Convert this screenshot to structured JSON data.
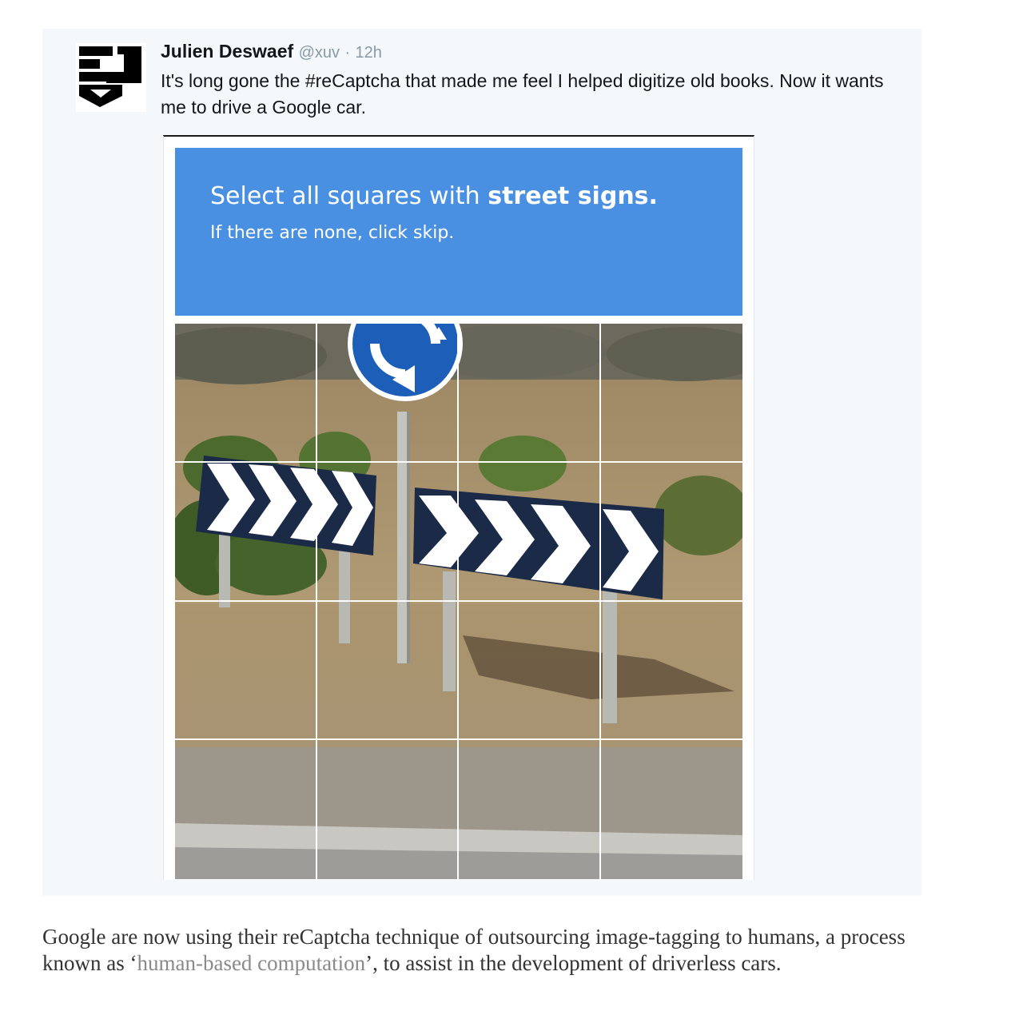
{
  "tweet": {
    "author_name": "Julien Deswaef",
    "handle": "@xuv",
    "separator": "·",
    "time": "12h",
    "text": "It's long gone the #reCaptcha that made me feel I helped digitize old books. Now it wants me to drive a Google car.",
    "avatar_icon": "xuv-logo-icon"
  },
  "captcha": {
    "prompt_prefix": "Select all squares with ",
    "prompt_target": "street signs.",
    "instruction": "If there are none, click skip.",
    "header_color": "#4a90e2",
    "grid": {
      "rows": 4,
      "cols": 4
    }
  },
  "article": {
    "caption_before": "Google are now using their reCaptcha technique of outsourcing image-tagging to humans, a process known as ‘",
    "caption_link": "human-based computation",
    "caption_after": "’, to assist in the development of driverless cars."
  }
}
